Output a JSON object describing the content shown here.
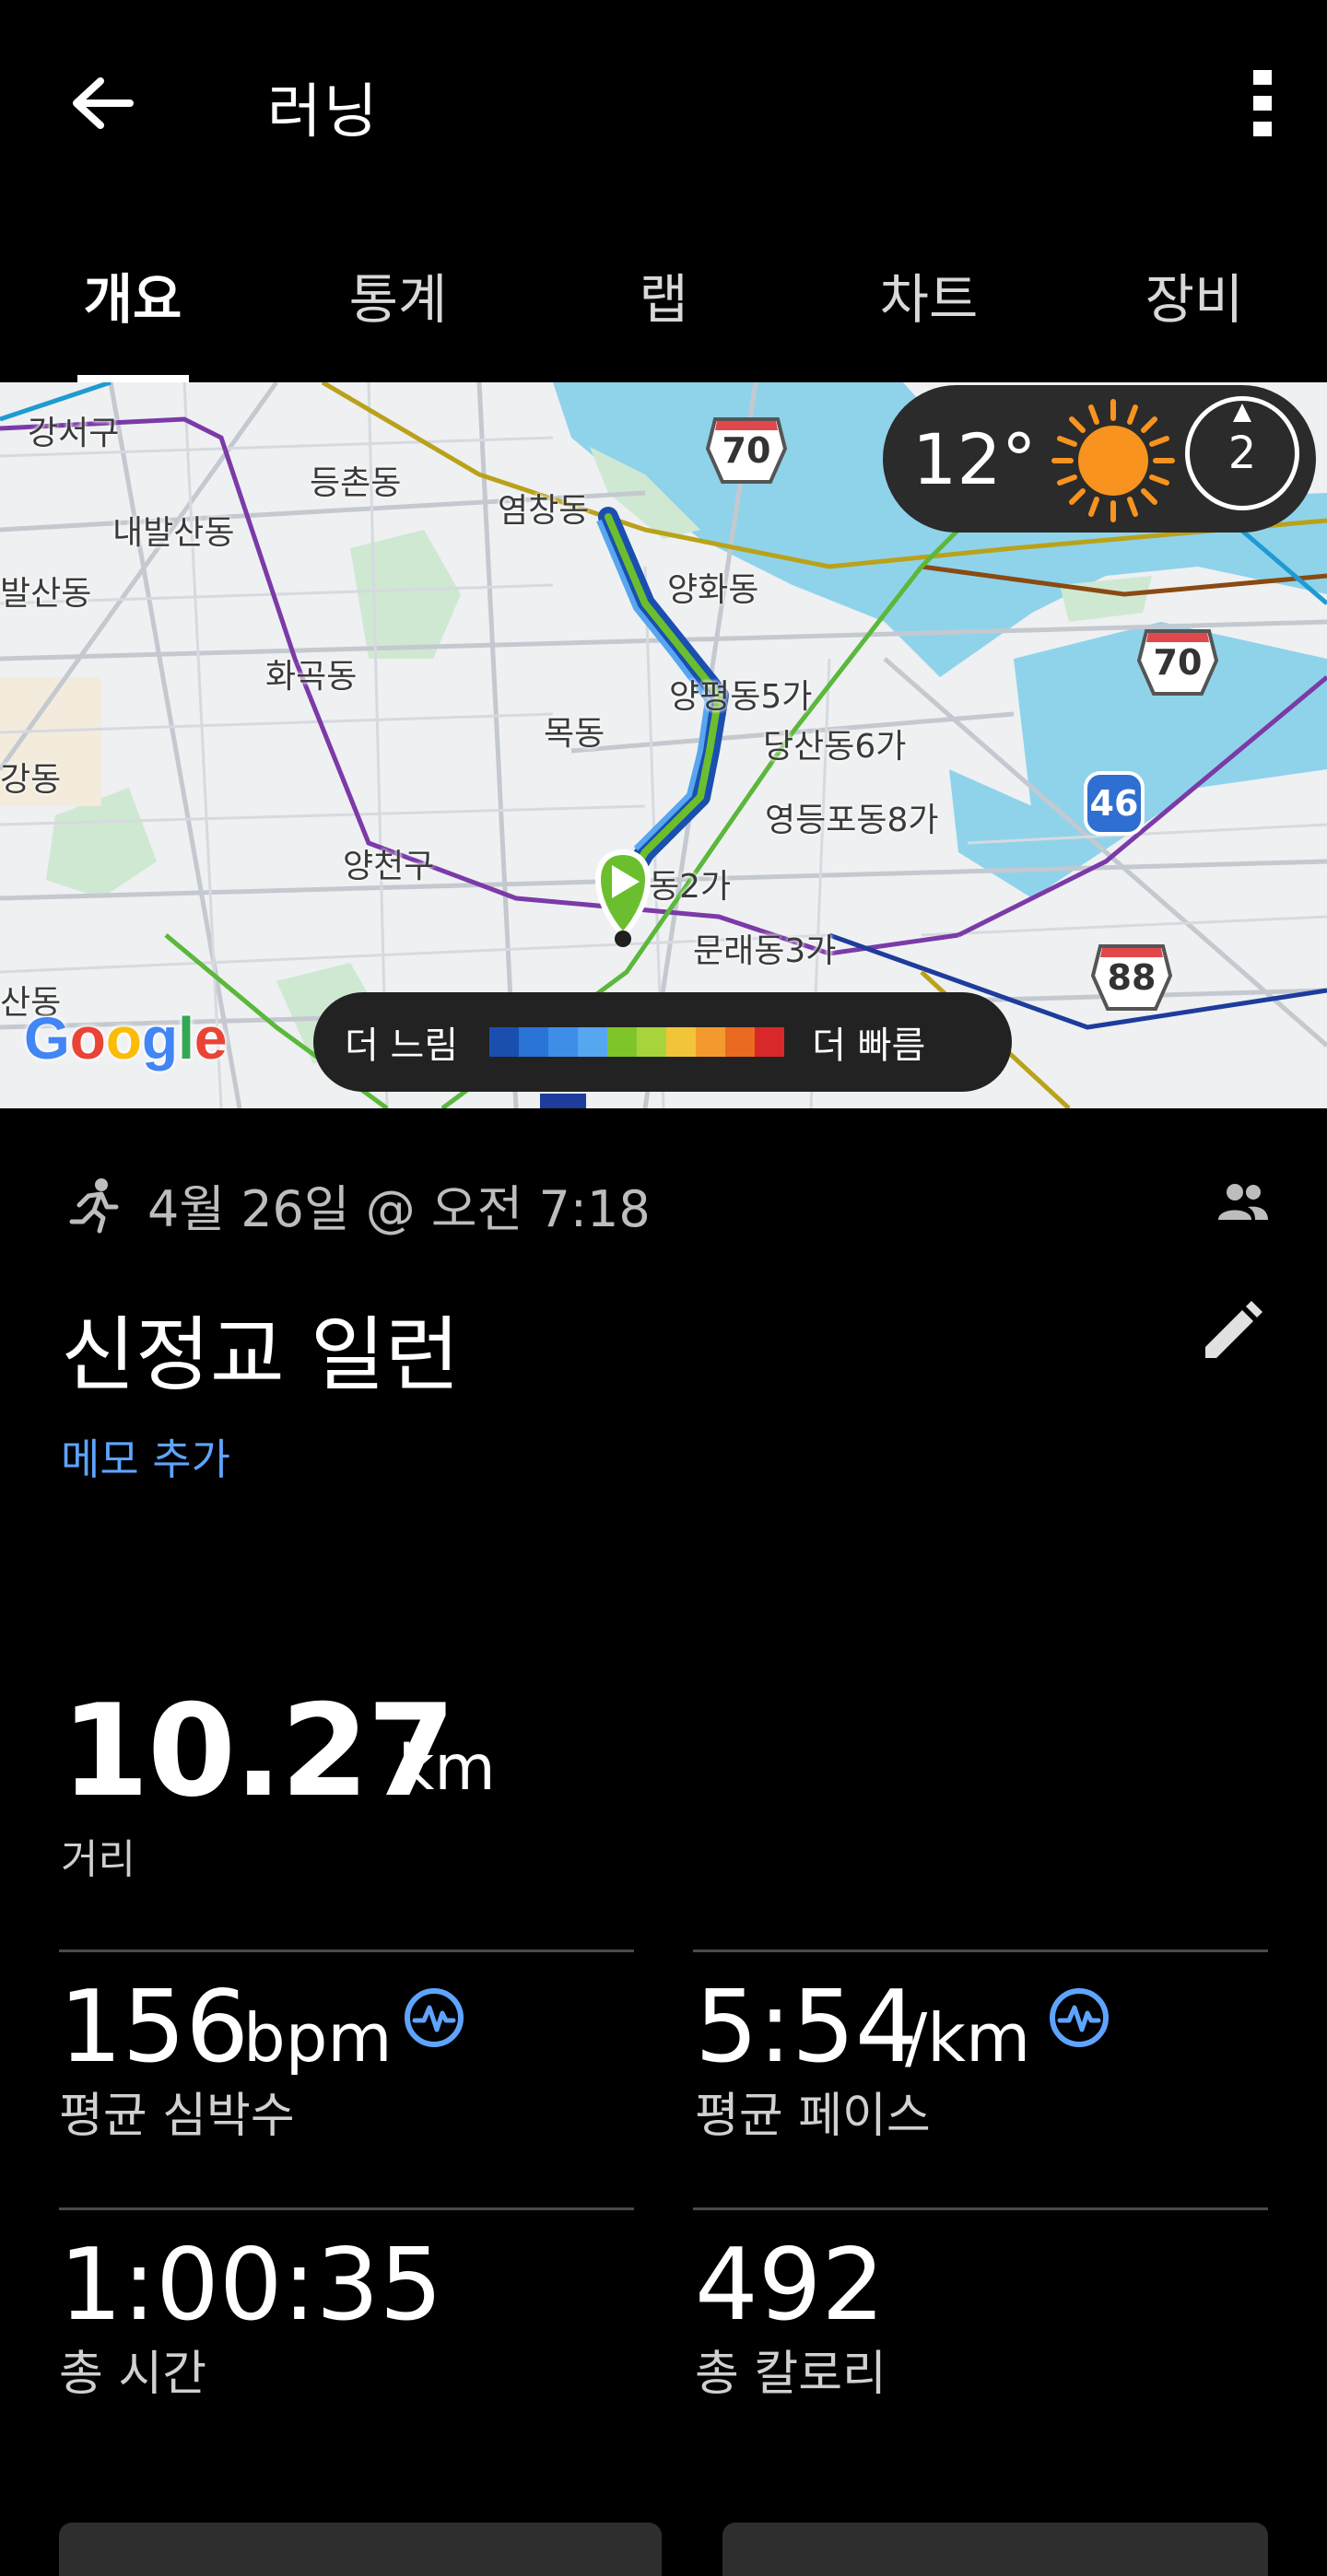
{
  "app_bar": {
    "title": "러닝"
  },
  "tabs": [
    {
      "label": "개요",
      "active": true
    },
    {
      "label": "통계",
      "active": false
    },
    {
      "label": "랩",
      "active": false
    },
    {
      "label": "차트",
      "active": false
    },
    {
      "label": "장비",
      "active": false
    }
  ],
  "map": {
    "labels": [
      "강서구",
      "등촌동",
      "염창동",
      "내발산동",
      "발산동",
      "양화동",
      "화곡동",
      "양평동5가",
      "목동",
      "당산동6가",
      "강동",
      "영등포동8가",
      "양천구",
      "동2가",
      "문래동3가",
      "산동"
    ],
    "route_shields": [
      "70",
      "70",
      "88"
    ],
    "blue_shield": "46",
    "weather": {
      "temperature": "12°",
      "condition_icon": "sun-icon",
      "wind_value": "2"
    },
    "legend": {
      "slow": "더 느림",
      "fast": "더 빠름",
      "colors": [
        "#1a4fb0",
        "#2a74d8",
        "#3e8ee8",
        "#57a6f0",
        "#7ec52a",
        "#a6d43a",
        "#f2c43a",
        "#f29a2e",
        "#ea6a22",
        "#d8282a"
      ]
    },
    "attribution": "Google"
  },
  "activity": {
    "date": "4월 26일 @ 오전 7:18",
    "title": "신정교 일런",
    "memo_link": "메모 추가"
  },
  "stats": {
    "distance": {
      "value": "10.27",
      "unit": "km",
      "label": "거리"
    },
    "heart_rate": {
      "value": "156",
      "unit": "bpm",
      "label": "평균 심박수"
    },
    "pace": {
      "value": "5:54",
      "unit": "/km",
      "label": "평균 페이스"
    },
    "time": {
      "value": "1:00:35",
      "label": "총 시간"
    },
    "calories": {
      "value": "492",
      "label": "총 칼로리"
    }
  },
  "colors": {
    "accent_blue": "#5ea4ff",
    "background": "#000000",
    "route_green": "#6bbf2e",
    "route_blue": "#2a74d8"
  }
}
